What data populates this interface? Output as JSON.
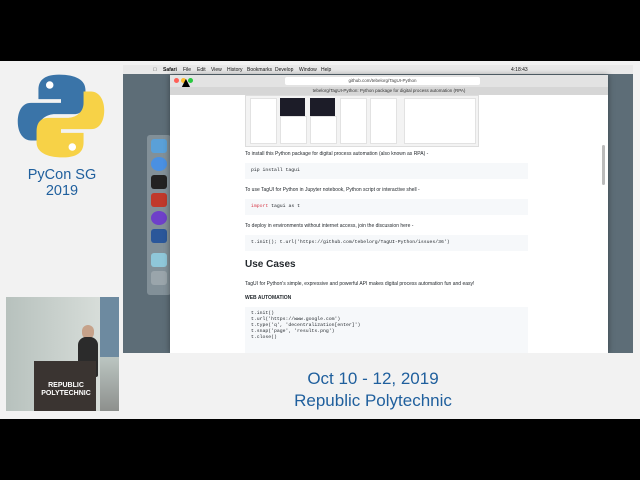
{
  "branding": {
    "conference": "PyCon SG 2019",
    "dates": "Oct 10 - 12, 2019",
    "venue": "Republic Polytechnic",
    "podium_text": "REPUBLIC POLYTECHNIC"
  },
  "menubar": {
    "items": [
      "Safari",
      "File",
      "Edit",
      "View",
      "History",
      "Bookmarks",
      "Develop",
      "Window",
      "Help"
    ],
    "clock": "4:18:43"
  },
  "browser": {
    "url": "github.com/tebelorg/TagUI-Python",
    "tab_title": "tebelorg/TagUI-Python: Python package for digital process automation (RPA)"
  },
  "page": {
    "install_intro": "To install this Python package for digital process automation (also known as RPA) -",
    "install_cmd": "pip install tagui",
    "use_intro": "To use TagUI for Python in Jupyter notebook, Python script or interactive shell -",
    "import_kw": "import",
    "import_rest": "tagui as t",
    "deploy_intro": "To deploy in environments without internet access, join the discussion here -",
    "deploy_cmd": "t.init(); t.url('https://github.com/tebelorg/TagUI-Python/issues/36')",
    "use_cases_heading": "Use Cases",
    "use_cases_desc": "TagUI for Python's simple, expressive and powerful API makes digital process automation fun and easy!",
    "web_heading": "WEB AUTOMATION",
    "web_code": [
      "t.init()",
      "t.url('https://www.google.com')",
      "t.type('q', 'decentralization[enter]')",
      "t.snap('page', 'results.png')",
      "t.close()"
    ]
  },
  "colors": {
    "brand_blue": "#1f5f9d",
    "python_blue": "#3a74a8",
    "python_yellow": "#f7d247"
  }
}
